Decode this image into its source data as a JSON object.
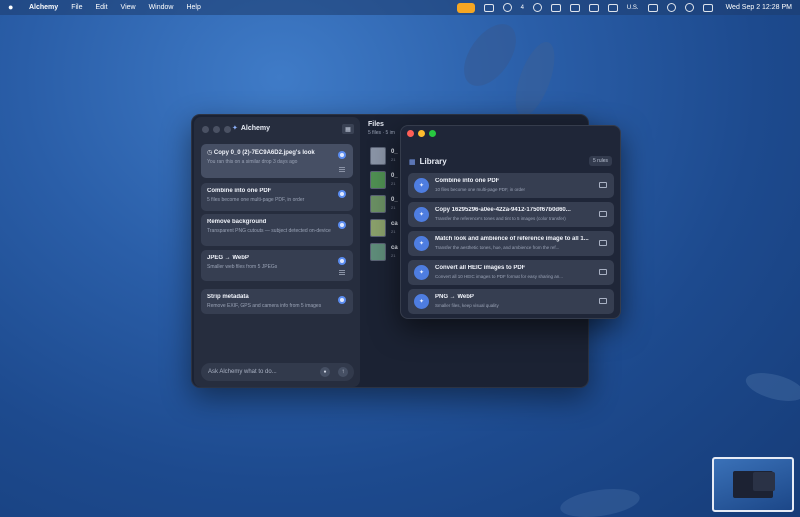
{
  "menubar": {
    "app_name": "Alchemy",
    "menus": [
      "File",
      "Edit",
      "View",
      "Window",
      "Help"
    ],
    "status_badge_count": "4",
    "input_source": "U.S.",
    "clock": "Wed Sep 2  12:28 PM"
  },
  "main_window": {
    "title": "Alchemy",
    "tasks": [
      {
        "title": "Copy 0_0 (2)-7EC9A6D2.jpeg's look",
        "subtitle": "You ran this on a similar drop 3 days ago",
        "prefix_icon": "clock-icon"
      },
      {
        "title": "Combine into one PDF",
        "subtitle": "5 files become one multi-page PDF, in order"
      },
      {
        "title": "Remove background",
        "subtitle": "Transparent PNG cutouts — subject detected on-device"
      },
      {
        "title": "JPEG → WebP",
        "subtitle": "Smaller web files from 5 JPEGs"
      },
      {
        "title": "Strip metadata",
        "subtitle": "Remove EXIF, GPS and camera info from 5 images"
      }
    ],
    "ask_placeholder": "Ask Alchemy what to do...",
    "files": {
      "title": "Files",
      "subtitle": "5 files · 5 im",
      "items": [
        {
          "name": "0_",
          "meta": "21"
        },
        {
          "name": "0_",
          "meta": "21"
        },
        {
          "name": "0_",
          "meta": "21"
        },
        {
          "name": "ca",
          "meta": "21"
        },
        {
          "name": "ca",
          "meta": "21"
        }
      ],
      "thumb_colors": [
        "#8a94a6",
        "#4f8f52",
        "#6a8f63",
        "#8aa06b",
        "#5f8d7a"
      ]
    }
  },
  "library": {
    "title": "Library",
    "rule_count": "5 rules",
    "rules": [
      {
        "title": "Combine into one PDF",
        "subtitle": "10 files become one multi-page PDF, in order"
      },
      {
        "title": "Copy 16295296-a0ee-422a-9412-1750f67b0d60...",
        "subtitle": "Transfer the reference's tones and tint to 5 images (color transfer)"
      },
      {
        "title": "Match look and ambience of reference image to all 1...",
        "subtitle": "Transfer the aesthetic tones, hue, and ambience from the ref..."
      },
      {
        "title": "Convert all HEIC images to PDF",
        "subtitle": "Convert all 10 HEIC images to PDF format for easy sharing an..."
      },
      {
        "title": "PNG → WebP",
        "subtitle": "Smaller files, keep visual quality"
      }
    ]
  },
  "colors": {
    "accent": "#5a8cf0",
    "alchemy_status": "#f5a623"
  }
}
